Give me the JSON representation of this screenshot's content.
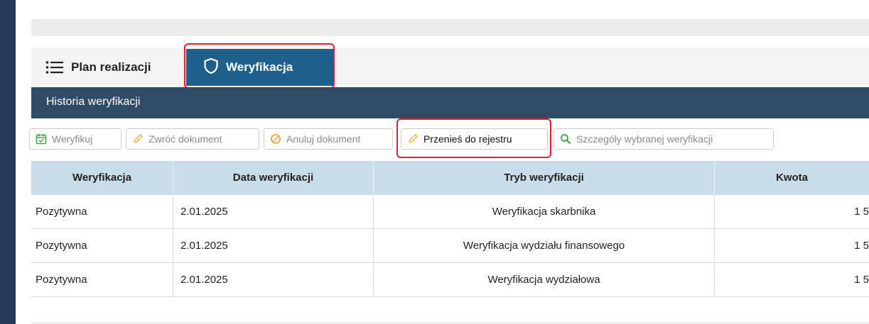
{
  "tabs": {
    "plan_label": "Plan realizacji",
    "weryf_label": "Weryfikacja"
  },
  "section": {
    "title": "Historia weryfikacji"
  },
  "toolbar": {
    "weryfikuj": "Weryfikuj",
    "zwroc": "Zwróć dokument",
    "anuluj": "Anuluj dokument",
    "przenies": "Przenieś do rejestru",
    "szczegoly": "Szczegóły wybranej weryfikacji"
  },
  "table": {
    "headers": [
      "Weryfikacja",
      "Data weryfikacji",
      "Tryb weryfikacji",
      "Kwota"
    ],
    "rows": [
      [
        "Pozytywna",
        "2.01.2025",
        "Weryfikacja skarbnika",
        "1 5"
      ],
      [
        "Pozytywna",
        "2.01.2025",
        "Weryfikacja wydziału finansowego",
        "1 5"
      ],
      [
        "Pozytywna",
        "2.01.2025",
        "Weryfikacja wydziałowa",
        "1 5"
      ]
    ]
  },
  "colors": {
    "tab_active": "#1f5f8b",
    "section_header": "#2f4b66",
    "highlight": "#e11d2e",
    "table_header": "#c9dce9"
  }
}
